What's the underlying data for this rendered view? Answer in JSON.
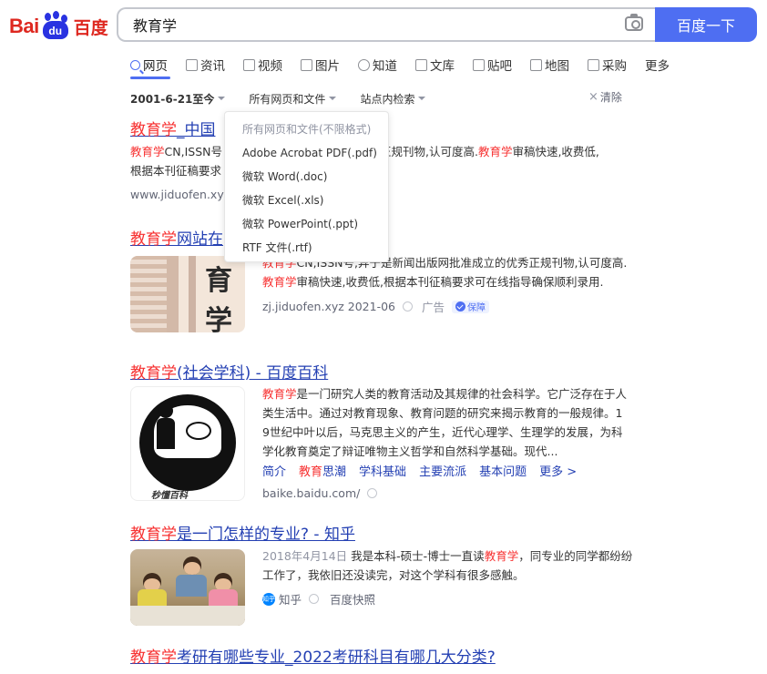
{
  "logo": {
    "bai": "Bai",
    "du": "du",
    "cn": "百度"
  },
  "search": {
    "query": "教育学",
    "button": "百度一下"
  },
  "tabs": [
    {
      "label": "网页",
      "icon": "search-icon"
    },
    {
      "label": "资讯",
      "icon": "news-icon"
    },
    {
      "label": "视频",
      "icon": "video-icon"
    },
    {
      "label": "图片",
      "icon": "image-icon"
    },
    {
      "label": "知道",
      "icon": "question-icon"
    },
    {
      "label": "文库",
      "icon": "doc-icon"
    },
    {
      "label": "贴吧",
      "icon": "tieba-icon"
    },
    {
      "label": "地图",
      "icon": "map-icon"
    },
    {
      "label": "采购",
      "icon": "cart-icon"
    },
    {
      "label": "更多",
      "icon": ""
    }
  ],
  "filters": {
    "time": "2001-6-21至今",
    "filetype": "所有网页和文件",
    "site": "站点内检索",
    "clear": "清除"
  },
  "dropdown": {
    "items": [
      "所有网页和文件(不限格式)",
      "Adobe Acrobat PDF(.pdf)",
      "微软 Word(.doc)",
      "微软 Excel(.xls)",
      "微软 PowerPoint(.ppt)",
      "RTF 文件(.rtf)"
    ]
  },
  "results": {
    "r1": {
      "title_em": "教育学",
      "title_rest": "_中国",
      "abs_l1_em": "教育学",
      "abs_l1_a": "CN,ISSN号",
      "abs_l1_b": "优秀正规刊物,认可度高.",
      "abs_l1_em2": "教育学",
      "abs_l1_c": "审稿快速,收费低,",
      "abs_l2": "根据本刊征稿要求",
      "url": "www.jiduofen.xyz"
    },
    "r2": {
      "title_em": "教育学",
      "title_rest": "网站在",
      "abs_l1_em": "教育学",
      "abs_l1_a": "CN,ISSN号,异于是新闻出版网批准成立的优秀正规刊物,认可度高.",
      "abs_l2_em": "教育学",
      "abs_l2_a": "审稿快速,收费低,根据本刊征稿要求可在线指导确保顺利录用.",
      "url": "zj.jiduofen.xyz 2021-06",
      "ad": "广告",
      "badge": "保障",
      "thumb_text": "育学"
    },
    "r3": {
      "title_em": "教育学",
      "title_rest": "(社会学科) - 百度百科",
      "l1_em": "教育学",
      "l1": "是一门研究人类的教育活动及其规律的社会科学。它广泛存在于人",
      "l2": "类生活中。通过对教育现象、教育问题的研究来揭示教育的一般规律。1",
      "l3": "9世纪中叶以后，马克思主义的产生，近代心理学、生理学的发展，为科",
      "l4": "学化教育奠定了辩证唯物主义哲学和自然科学基础。现代...",
      "links": [
        "简介",
        "思潮",
        "学科基础",
        "主要流派",
        "基本问题",
        "更多 >"
      ],
      "links_em": "教育",
      "url": "baike.baidu.com/",
      "thumb_logo": "秒懂百科"
    },
    "r4": {
      "title_em": "教育学",
      "title_rest": "是一门怎样的专业? - 知乎",
      "date": "2018年4月14日",
      "l1_a": "我是本科-硕士-博士一直读",
      "l1_em": "教育学",
      "l1_b": "，同专业的同学都纷纷",
      "l2": "工作了，我依旧还没读完，对这个学科有很多感触。",
      "source": "知乎",
      "source_icon": "知乎",
      "snapshot": "百度快照"
    },
    "r5": {
      "title_em": "教育学",
      "title_rest": "考研有哪些专业_2022考研科目有哪几大分类?"
    }
  },
  "colors": {
    "accent": "#4e6ef2",
    "link": "#2440b3",
    "highlight": "#f73131",
    "brand_red": "#de2820",
    "brand_blue": "#2932e1"
  }
}
